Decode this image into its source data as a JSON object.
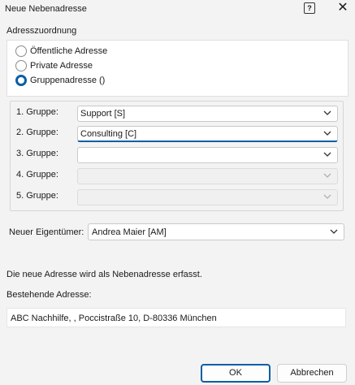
{
  "window": {
    "title": "Neue Nebenadresse",
    "help_icon": "help-icon",
    "close_icon": "close-icon"
  },
  "assignment": {
    "title": "Adresszuordnung",
    "options": [
      {
        "label": "Öffentliche Adresse",
        "checked": false
      },
      {
        "label": "Private Adresse",
        "checked": false
      },
      {
        "label": "Gruppenadresse ()",
        "checked": true
      }
    ]
  },
  "groups": [
    {
      "label": "1. Gruppe:",
      "value": "Support [S]",
      "enabled": true
    },
    {
      "label": "2. Gruppe:",
      "value": "Consulting [C]",
      "enabled": true
    },
    {
      "label": "3. Gruppe:",
      "value": "",
      "enabled": true
    },
    {
      "label": "4. Gruppe:",
      "value": "",
      "enabled": false
    },
    {
      "label": "5. Gruppe:",
      "value": "",
      "enabled": false
    }
  ],
  "owner": {
    "label": "Neuer Eigentümer:",
    "value": "Andrea Maier [AM]"
  },
  "info_text": "Die neue Adresse wird als Nebenadresse erfasst.",
  "existing": {
    "label": "Bestehende Adresse:",
    "value": "ABC Nachhilfe,  , Poccistraße 10, D-80336 München"
  },
  "buttons": {
    "ok": "OK",
    "cancel": "Abbrechen"
  },
  "colors": {
    "accent": "#0a5ea8",
    "background": "#f3f3f3"
  }
}
